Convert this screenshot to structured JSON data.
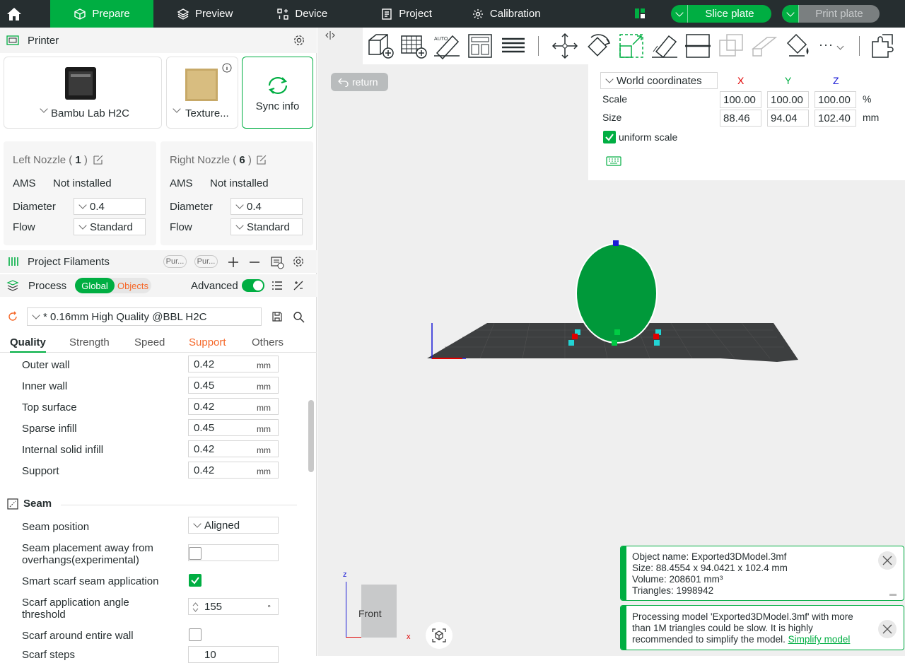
{
  "topbar": {
    "prepare": "Prepare",
    "preview": "Preview",
    "device": "Device",
    "project": "Project",
    "calibration": "Calibration",
    "slice": "Slice plate",
    "print": "Print plate"
  },
  "printer": {
    "title": "Printer",
    "name": "Bambu Lab H2C",
    "plate": "Texture...",
    "sync": "Sync info"
  },
  "left_nozzle": {
    "title": "Left Nozzle",
    "num": "1",
    "ams_label": "AMS",
    "ams_value": "Not installed",
    "diameter_label": "Diameter",
    "diameter": "0.4",
    "flow_label": "Flow",
    "flow": "Standard"
  },
  "right_nozzle": {
    "title": "Right Nozzle",
    "num": "6",
    "ams_label": "AMS",
    "ams_value": "Not installed",
    "diameter_label": "Diameter",
    "diameter": "0.4",
    "flow_label": "Flow",
    "flow": "Standard"
  },
  "filaments": {
    "title": "Project Filaments",
    "pill1": "Pur...",
    "pill2": "Pur..."
  },
  "process": {
    "title": "Process",
    "global": "Global",
    "objects": "Objects",
    "advanced": "Advanced",
    "preset": "* 0.16mm High Quality @BBL H2C"
  },
  "tabs": [
    "Quality",
    "Strength",
    "Speed",
    "Support",
    "Others"
  ],
  "widths": [
    {
      "label": "Outer wall",
      "value": "0.42",
      "unit": "mm"
    },
    {
      "label": "Inner wall",
      "value": "0.45",
      "unit": "mm"
    },
    {
      "label": "Top surface",
      "value": "0.42",
      "unit": "mm"
    },
    {
      "label": "Sparse infill",
      "value": "0.45",
      "unit": "mm"
    },
    {
      "label": "Internal solid infill",
      "value": "0.42",
      "unit": "mm"
    },
    {
      "label": "Support",
      "value": "0.42",
      "unit": "mm"
    }
  ],
  "seam": {
    "title": "Seam",
    "position_label": "Seam position",
    "position": "Aligned",
    "placement_label1": "Seam placement away from",
    "placement_label2": "overhangs(experimental)",
    "placement": false,
    "smart_label": "Smart scarf seam application",
    "smart": true,
    "angle_label1": "Scarf application angle",
    "angle_label2": "threshold",
    "angle": "155",
    "angle_unit": "°",
    "around_label": "Scarf around entire wall",
    "around": false,
    "steps_label": "Scarf steps",
    "steps": "10"
  },
  "viewport": {
    "return": "return",
    "coords": "World coordinates",
    "x": "X",
    "y": "Y",
    "z": "Z",
    "scale_label": "Scale",
    "scale": [
      "100.00",
      "100.00",
      "100.00"
    ],
    "scale_unit": "%",
    "size_label": "Size",
    "size": [
      "88.46",
      "94.04",
      "102.40"
    ],
    "size_unit": "mm",
    "uniform": "uniform scale",
    "cube_label": "Front",
    "axis_x": "x",
    "axis_z": "z"
  },
  "notes": {
    "obj_name": "Object name: Exported3DModel.3mf",
    "obj_size": "Size: 88.4554 x 94.0421 x 102.4 mm",
    "obj_volume": "Volume: 208601 mm³",
    "obj_tris": "Triangles: 1998942",
    "warn1": "Processing model 'Exported3DModel.3mf' with more",
    "warn2": "than 1M triangles could be slow. It is highly",
    "warn3": "recommended to simplify the model.",
    "warn_link": "Simplify model"
  },
  "colors": {
    "accent": "#00ae42",
    "topbar": "#262e30",
    "support_tab": "#f5692b",
    "axis_x": "#e00000",
    "axis_y": "#00ae42",
    "axis_z": "#1a1ad6"
  }
}
